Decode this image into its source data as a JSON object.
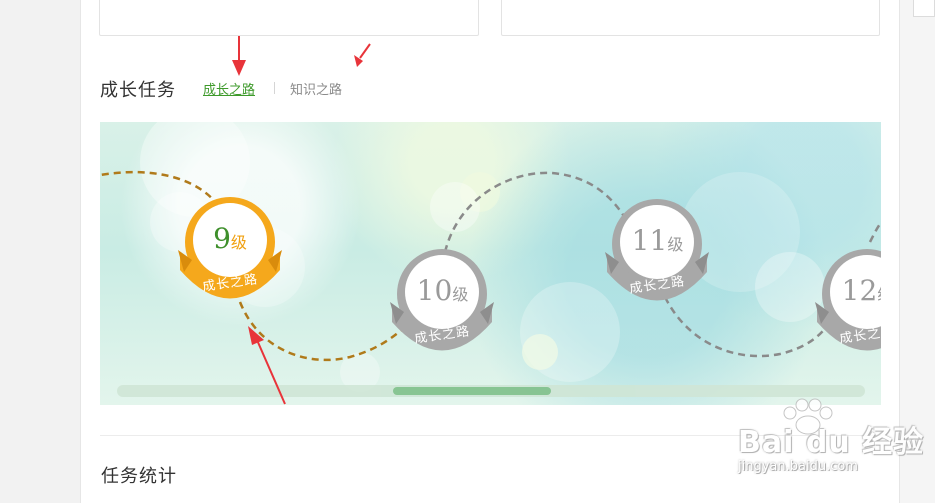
{
  "growth_section": {
    "title": "成长任务",
    "tabs": [
      {
        "label": "成长之路",
        "active": true
      },
      {
        "label": "知识之路",
        "active": false
      }
    ]
  },
  "levels": [
    {
      "number": "9",
      "unit": "级",
      "ribbon": "成长之路",
      "state": "current",
      "color": "#f5a81c"
    },
    {
      "number": "10",
      "unit": "级",
      "ribbon": "成长之路",
      "state": "locked",
      "color": "#a8a8a8"
    },
    {
      "number": "11",
      "unit": "级",
      "ribbon": "成长之路",
      "state": "locked",
      "color": "#a8a8a8"
    },
    {
      "number": "12",
      "unit": "级",
      "ribbon": "成长之路",
      "state": "locked",
      "color": "#a8a8a8"
    }
  ],
  "path_colors": {
    "completed": "#b07a1a",
    "pending": "#8a8a8a"
  },
  "banner_scroll": {
    "thumb_fraction": 0.21,
    "position_fraction": 0.37
  },
  "stats_section": {
    "title": "任务统计"
  },
  "watermark": {
    "brand": "Bai du 经验",
    "url": "jingyan.baidu.com"
  }
}
